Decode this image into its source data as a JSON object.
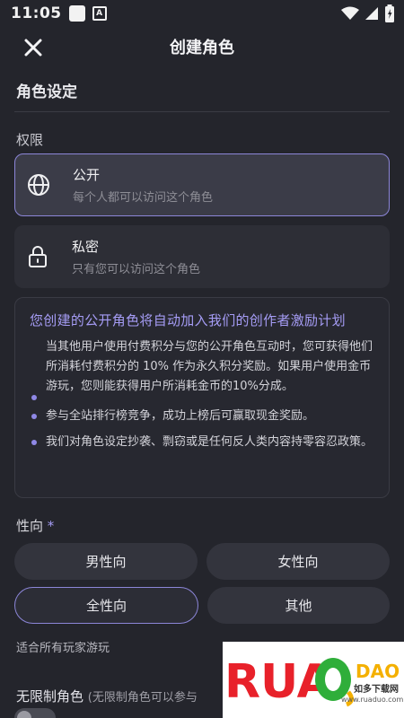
{
  "status_bar": {
    "time": "11:05",
    "a_badge": "A"
  },
  "header": {
    "title": "创建角色"
  },
  "section": {
    "title": "角色设定"
  },
  "permission": {
    "label": "权限",
    "options": [
      {
        "title": "公开",
        "subtitle": "每个人都可以访问这个角色",
        "icon": "globe-icon",
        "selected": true
      },
      {
        "title": "私密",
        "subtitle": "只有您可以访问这个角色",
        "icon": "lock-icon",
        "selected": false
      }
    ]
  },
  "info": {
    "title": "您创建的公开角色将自动加入我们的创作者激励计划",
    "bullets": [
      "当其他用户使用付费积分与您的公开角色互动时，您可获得他们所消耗付费积分的 10% 作为永久积分奖励。如果用户使用金币游玩，您则能获得用户所消耗金币的10%分成。",
      "参与全站排行榜竞争，成功上榜后可赢取现金奖励。",
      "我们对角色设定抄袭、剽窃或是任何反人类内容持零容忍政策。"
    ]
  },
  "orientation": {
    "label": "性向",
    "required_mark": "*",
    "options": [
      "男性向",
      "女性向",
      "全性向",
      "其他"
    ],
    "selected": "全性向",
    "hint": "适合所有玩家游玩"
  },
  "unrestricted": {
    "label": "无限制角色",
    "sub": "(无限制角色可以参与"
  },
  "watermark": {
    "brand": "RUANDAO",
    "sub": "如多下载网",
    "url": "www.ruaduo.com"
  },
  "colors": {
    "accent": "#8c86d8",
    "background": "#24252c",
    "info_title": "#a59cf5"
  }
}
